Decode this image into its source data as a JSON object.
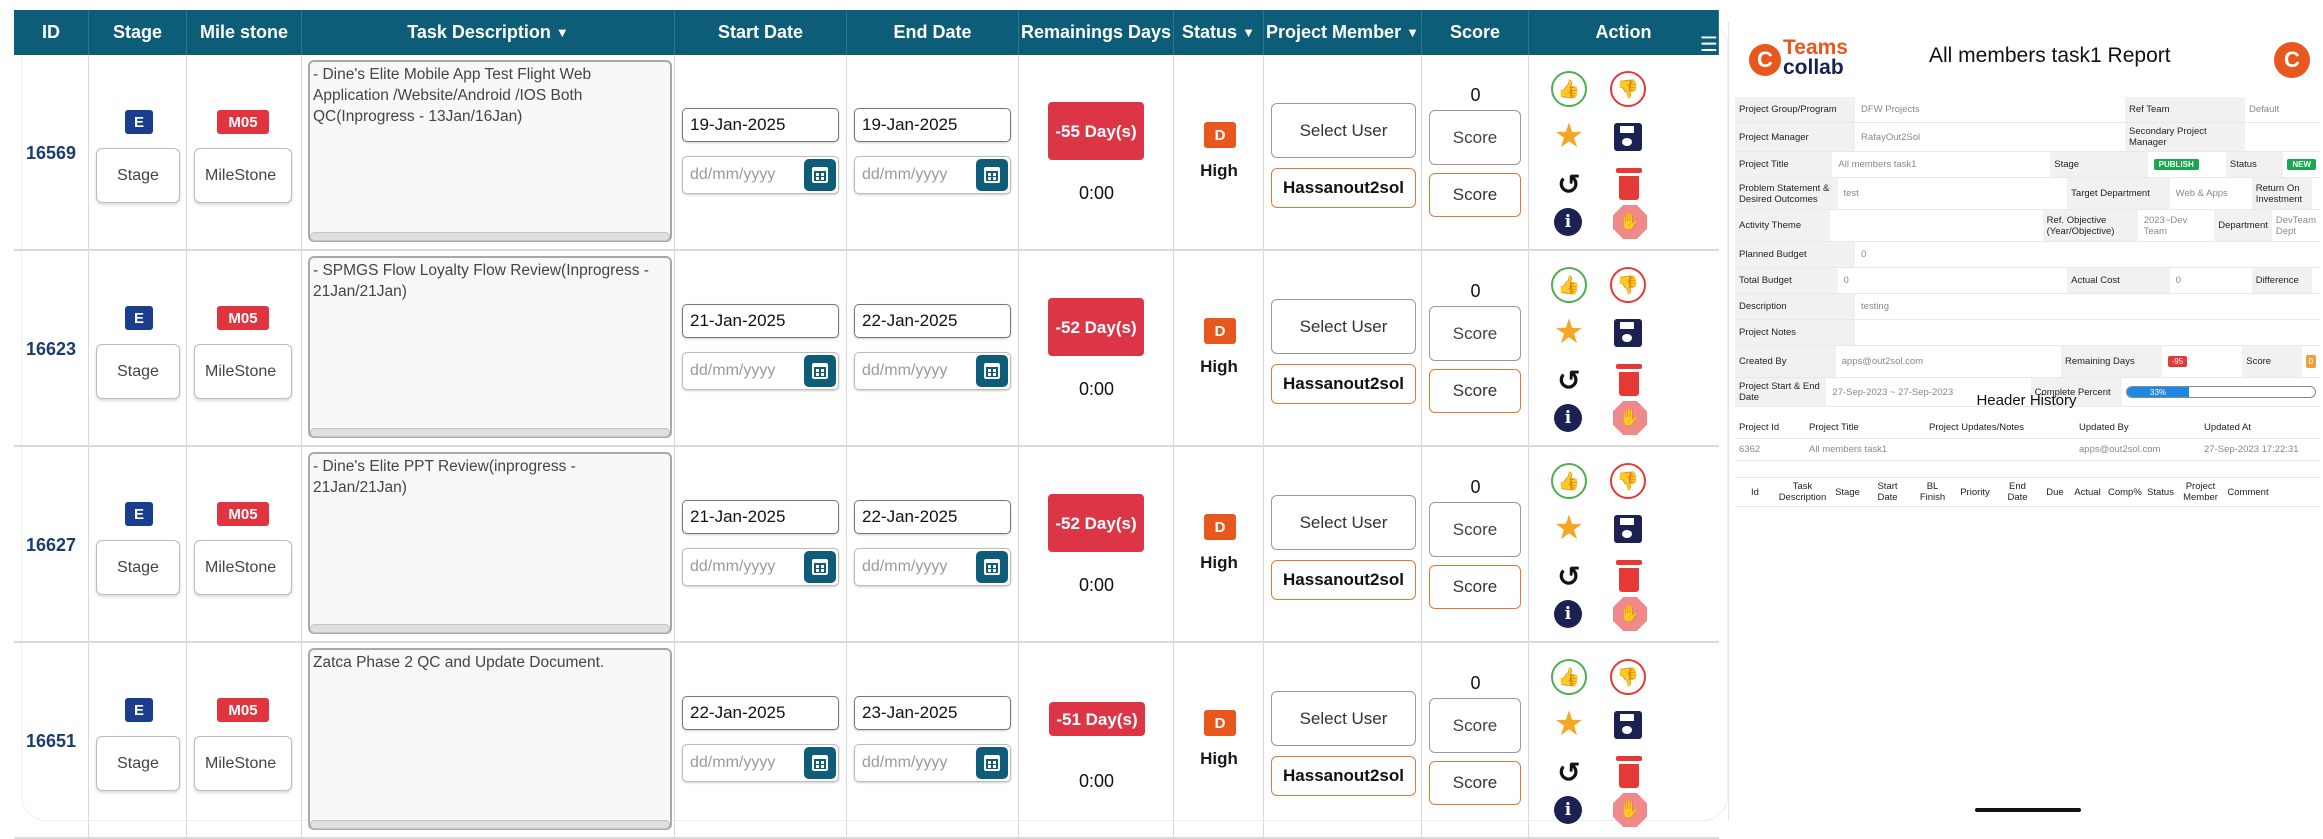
{
  "table": {
    "columns": [
      {
        "label": "ID",
        "w": 75
      },
      {
        "label": "Stage",
        "w": 98
      },
      {
        "label": "Mile stone",
        "w": 115
      },
      {
        "label": "Task Description",
        "arrow": "▼",
        "w": 373
      },
      {
        "label": "Start Date",
        "w": 172
      },
      {
        "label": "End Date",
        "w": 172
      },
      {
        "label": "Remainings Days",
        "w": 155
      },
      {
        "label": "Status",
        "arrow": "▼",
        "w": 90
      },
      {
        "label": "Project Member",
        "arrow": "▼",
        "w": 158
      },
      {
        "label": "Score",
        "w": 107
      },
      {
        "label": "Action",
        "w": 190
      }
    ],
    "date_placeholder": "dd/mm/yyyy",
    "stage_placeholder": "Stage",
    "milestone_placeholder": "MileStone",
    "member_placeholder": "Select User",
    "score_placeholder": "Score",
    "rows": [
      {
        "id": "16569",
        "stage": "E",
        "milestone": "M05",
        "description": "- Dine's Elite Mobile App Test Flight Web Application /Website/Android /IOS Both QC(Inprogress - 13Jan/16Jan)",
        "start": "19-Jan-2025",
        "end": "19-Jan-2025",
        "remaining": "-55 Day(s)",
        "time": "0:00",
        "status": "D",
        "priority": "High",
        "member": "Hassanout2sol",
        "score": "0"
      },
      {
        "id": "16623",
        "stage": "E",
        "milestone": "M05",
        "description": "- SPMGS Flow Loyalty Flow Review(Inprogress - 21Jan/21Jan)",
        "start": "21-Jan-2025",
        "end": "22-Jan-2025",
        "remaining": "-52 Day(s)",
        "time": "0:00",
        "status": "D",
        "priority": "High",
        "member": "Hassanout2sol",
        "score": "0"
      },
      {
        "id": "16627",
        "stage": "E",
        "milestone": "M05",
        "description": "- Dine's Elite PPT Review(inprogress - 21Jan/21Jan)",
        "start": "21-Jan-2025",
        "end": "22-Jan-2025",
        "remaining": "-52 Day(s)",
        "time": "0:00",
        "status": "D",
        "priority": "High",
        "member": "Hassanout2sol",
        "score": "0"
      },
      {
        "id": "16651",
        "stage": "E",
        "milestone": "M05",
        "description": "Zatca Phase 2 QC and Update Document.",
        "start": "22-Jan-2025",
        "end": "23-Jan-2025",
        "remaining": "-51 Day(s)",
        "time": "0:00",
        "status": "D",
        "priority": "High",
        "member": "Hassanout2sol",
        "score": "0"
      }
    ]
  },
  "report": {
    "logo_line1": "Teams",
    "logo_line2": "collab",
    "title": "All members task1 Report",
    "fields": {
      "project_group_label": "Project Group/Program",
      "project_group": "DFW Projects",
      "ref_team_label": "Ref Team",
      "ref_team": "Default",
      "pm_label": "Project Manager",
      "pm": "RafayOut2Sol",
      "spm_label": "Secondary Project Manager",
      "spm": "",
      "title_label": "Project Title",
      "title": "All members task1",
      "stage_label": "Stage",
      "stage": "PUBLISH",
      "status_label": "Status",
      "status": "NEW",
      "problem_label": "Problem Statement & Desired Outcomes",
      "problem": "test",
      "target_label": "Target Department",
      "target": "Web & Apps",
      "roi_label": "Return On Investment",
      "roi": "",
      "theme_label": "Activity Theme",
      "theme": "",
      "ref_obj_label": "Ref. Objective (Year/Objective)",
      "ref_obj": "2023~Dev Team",
      "dept_label": "Department",
      "dept": "DevTeam Dept",
      "planned_label": "Planned Budget",
      "planned": "0",
      "total_label": "Total Budget",
      "total": "0",
      "actual_label": "Actual Cost",
      "actual": "0",
      "diff_label": "Difference",
      "diff": "",
      "desc_label": "Description",
      "desc": "testing",
      "notes_label": "Project Notes",
      "notes": "",
      "created_label": "Created By",
      "created": "apps@out2sol.com",
      "remaining_label": "Remaining Days",
      "remaining": "-95",
      "score_label": "Score",
      "score": "0",
      "dates_label": "Project Start & End Date",
      "dates": "27-Sep-2023 ~ 27-Sep-2023",
      "complete_label": "Complete Percent",
      "complete": "33%",
      "complete_value": 0.33
    },
    "header_history": {
      "title": "Header History",
      "columns": [
        "Project Id",
        "Project Title",
        "Project Updates/Notes",
        "Updated By",
        "Updated At"
      ],
      "row": [
        "6362",
        "All members task1",
        "",
        "apps@out2sol.com",
        "27-Sep-2023 17:22:31"
      ]
    },
    "task_columns": [
      "Id",
      "Task Description",
      "Stage",
      "Start Date",
      "BL Finish",
      "Priority",
      "End Date",
      "Due",
      "Actual",
      "Comp%",
      "Status",
      "Project Member",
      "Comment"
    ]
  }
}
